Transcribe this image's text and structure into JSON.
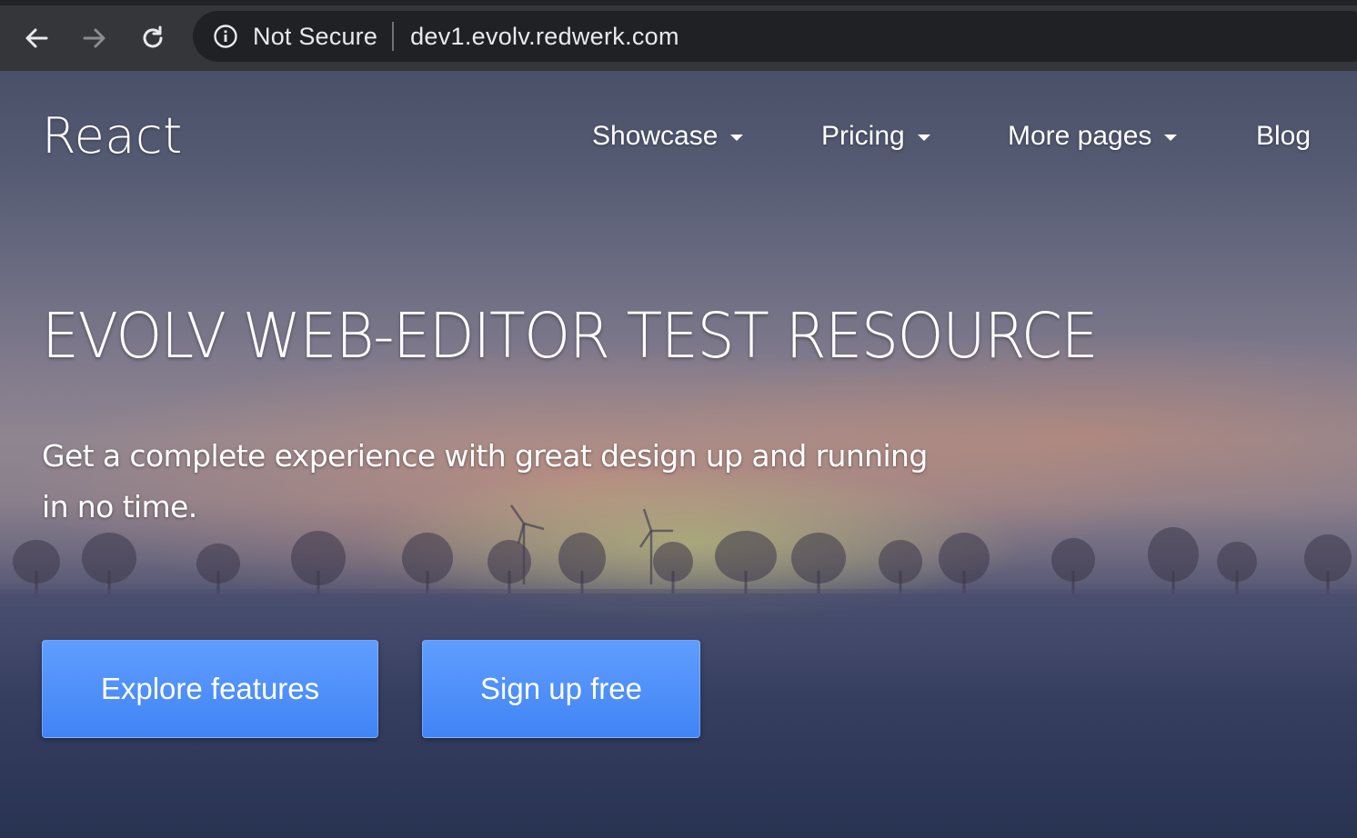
{
  "browser": {
    "security_label": "Not Secure",
    "url": "dev1.evolv.redwerk.com",
    "icons": {
      "back": "arrow-left-icon",
      "forward": "arrow-right-icon",
      "reload": "reload-icon",
      "info": "info-circle-icon"
    }
  },
  "navbar": {
    "brand": "React",
    "items": [
      {
        "label": "Showcase",
        "dropdown": true
      },
      {
        "label": "Pricing",
        "dropdown": true
      },
      {
        "label": "More pages",
        "dropdown": true
      },
      {
        "label": "Blog",
        "dropdown": false
      }
    ]
  },
  "hero": {
    "title": "EVOLV WEB-EDITOR TEST RESOURCE",
    "subtitle": "Get a complete experience with great design up and running in no time.",
    "buttons": {
      "primary": "Explore features",
      "secondary": "Sign up free"
    }
  },
  "colors": {
    "browser_bar": "#35363a",
    "omnibox": "#202124",
    "button": "#4f8ff9",
    "text": "#ffffff"
  }
}
